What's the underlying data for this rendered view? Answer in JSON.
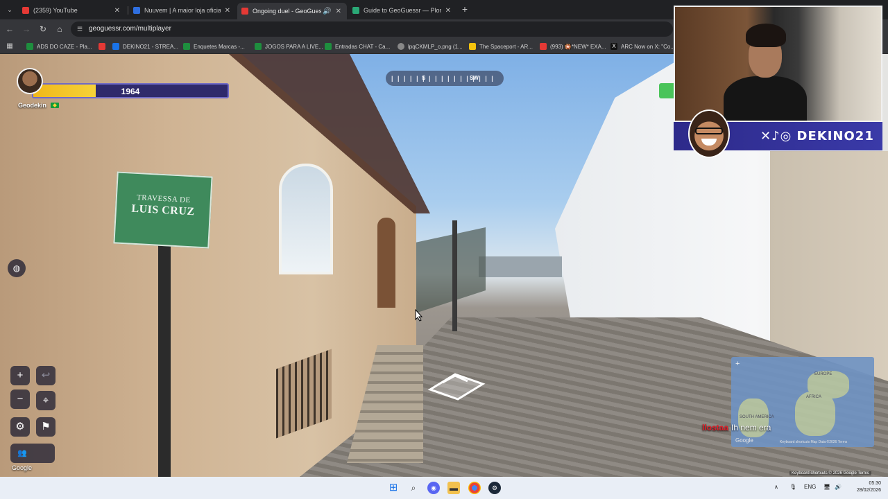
{
  "browser": {
    "tabs": [
      {
        "title": "(2359) YouTube",
        "color": "#e53935",
        "active": false
      },
      {
        "title": "Nuuvem | A maior loja oficial de",
        "color": "#2f6fe0",
        "active": false
      },
      {
        "title": "Ongoing duel - GeoGuessr",
        "color": "#e53935",
        "active": true
      },
      {
        "title": "Guide to GeoGuessr — Plonk It",
        "color": "#2aa876",
        "active": false
      }
    ],
    "tab_close": "✕",
    "new_tab": "+",
    "url": "geoguessr.com/multiplayer",
    "bookmarks": [
      {
        "label": "ADS DO CAZE - Pla...",
        "color": "#1e8e3e"
      },
      {
        "label": "",
        "color": "#e53935"
      },
      {
        "label": "DEKINO21 - STREA...",
        "color": "#1a73e8"
      },
      {
        "label": "Enquetes Marcas -...",
        "color": "#1e8e3e"
      },
      {
        "label": "JOGOS PARA A LIVE...",
        "color": "#1e8e3e"
      },
      {
        "label": "Entradas CHAT - Ca...",
        "color": "#1e8e3e"
      },
      {
        "label": "lpqCKMLP_o.png (1...",
        "color": "#888888"
      },
      {
        "label": "The Spaceport - AR...",
        "color": "#f4c20d"
      },
      {
        "label": "(993) 🎇*NEW* EXA...",
        "color": "#e53935"
      },
      {
        "label": "ARC Now on X: \"Co...",
        "color": "#111111"
      }
    ]
  },
  "game": {
    "player": {
      "name": "Geodekin",
      "health": 1964,
      "health_fraction": 0.32
    },
    "compass": {
      "ticks": "| | | | |    | | | | | | |    | | | | |",
      "dir_s": "S",
      "dir_sw": "SW"
    },
    "street_sign": {
      "line1": "TRAVESSA DE",
      "line2": "LUIS CRUZ"
    },
    "controls": {
      "zoom_in": "+",
      "zoom_out": "−",
      "undo": "↩",
      "checkpoint": "⌖",
      "settings": "⚙",
      "flag": "⚑",
      "players": "👥"
    },
    "google_label": "Google",
    "minimap": {
      "label_europe": "EUROPE",
      "label_africa": "AFRICA",
      "label_sa": "SOUTH AMERICA",
      "zoom": "+",
      "google": "Google",
      "footer": "Keyboard shortcuts   Map Data ©2026   Terms"
    },
    "chat": {
      "user": "llostaa",
      "message": "Ih nem era"
    },
    "attribution": "Keyboard shortcuts   © 2026 Google   Terms"
  },
  "stream": {
    "social_handle": "✕♪◎ DEKINO21"
  },
  "taskbar": {
    "lang": "ENG",
    "time": "05:30",
    "date": "28/02/2026",
    "tray_arrow": "∧"
  }
}
